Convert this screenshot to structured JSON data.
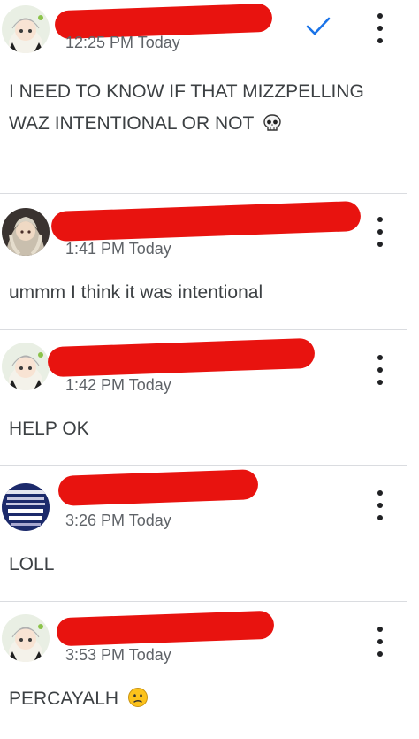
{
  "comments": [
    {
      "time": "12:25 PM Today",
      "text": "I NEED TO KNOW IF THAT MIZZPELLING WAZ INTENTIONAL OR NOT",
      "emoji": "skull-icon",
      "resolved": true
    },
    {
      "time": "1:41 PM Today",
      "text": "ummm I think it was intentional"
    },
    {
      "time": "1:42 PM Today",
      "text": "HELP OK"
    },
    {
      "time": "3:26 PM Today",
      "text": "LOLL"
    },
    {
      "time": "3:53 PM Today",
      "text": "PERCAYALH",
      "emoji": "slightly-frowning-face-icon"
    }
  ],
  "colors": {
    "redaction": "#e8130f",
    "check": "#1a73e8",
    "divider": "#dadce0",
    "text": "#3c4043",
    "time": "#5f6368"
  }
}
